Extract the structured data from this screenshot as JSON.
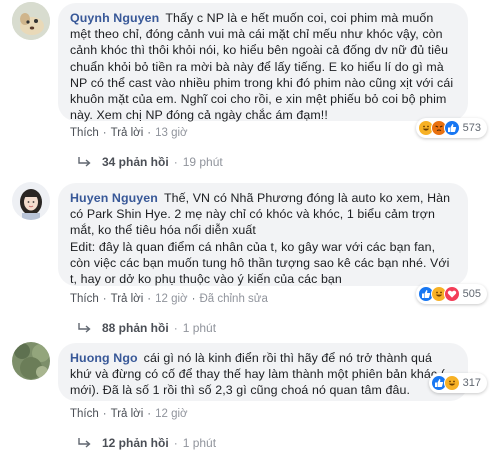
{
  "comments": [
    {
      "author": "Quynh Nguyen",
      "text": "Thấy c NP là e hết muốn coi, coi phim mà muốn mệt theo chỉ, đóng cảnh vui mà cái mặt chỉ mếu như khóc vậy, còn cảnh khóc thì thôi khỏi nói, ko hiểu bên ngoài cả đống dv nữ đủ tiêu chuẩn khỏi bỏ tiền ra mời bà này để lấy tiếng. E ko hiểu lí do gì mà NP có thể cast vào nhiều phim trong khi đó phim nào cũng xịt với cái khuôn mặt của em. Nghĩ coi cho rồi, e xin mệt phiếu bỏ coi bộ phim này. Xem chị NP đóng cả ngày chắc ám đạm!!",
      "actions": {
        "like": "Thích",
        "reply": "Trả lời",
        "time": "13 giờ"
      },
      "reactions": {
        "icons": [
          "haha-icon",
          "angry-icon",
          "like-icon"
        ],
        "count": "573"
      },
      "replies": {
        "count": "34 phản hồi",
        "time": "19 phút"
      }
    },
    {
      "author": "Huyen Nguyen",
      "text_lines": [
        "Thế, VN có Nhã Phương đóng là auto ko xem, Hàn có Park Shin Hye. 2 mẹ này chỉ có khóc và khóc, 1 biểu cảm trợn mắt, ko thể tiêu hóa nổi diễn xuất",
        "Edit: đây là quan điểm cá nhân của t, ko gây war với các bạn fan, còn việc các bạn muốn tung hô thần tượng sao kê các bạn nhé. Với t, hay or dở ko phụ thuộc vào ý kiến của các bạn"
      ],
      "actions": {
        "like": "Thích",
        "reply": "Trả lời",
        "time": "12 giờ",
        "edited": "Đã chỉnh sửa"
      },
      "reactions": {
        "icons": [
          "like-icon",
          "haha-icon",
          "love-icon"
        ],
        "count": "505"
      },
      "replies": {
        "count": "88 phản hồi",
        "time": "1 phút"
      }
    },
    {
      "author": "Huong Ngo",
      "text": "cái gì nó là kinh điển rồi thì hãy để nó trở thành quá khứ và đừng có cố để thay thế hay làm thành một phiên bản khác ( mới). Đã là số 1 rồi thì số 2,3 gì cũng choá nó quan tâm đâu.",
      "actions": {
        "like": "Thích",
        "reply": "Trả lời",
        "time": "12 giờ"
      },
      "reactions": {
        "icons": [
          "like-icon",
          "haha-icon"
        ],
        "count": "317"
      },
      "replies": {
        "count": "12 phản hồi",
        "time": "1 phút"
      }
    }
  ],
  "colors": {
    "author": "#385898",
    "bubble": "#f2f3f5",
    "like": "#1877f2",
    "haha": "#f7b125",
    "angry": "#e9710f",
    "love": "#f33e58"
  }
}
